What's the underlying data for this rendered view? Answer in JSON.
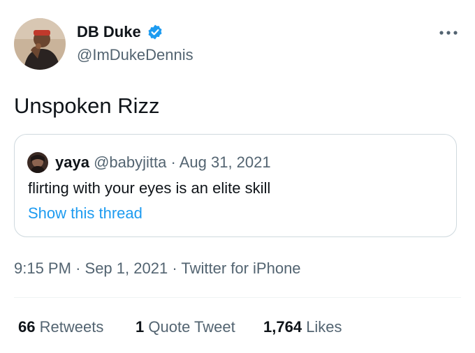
{
  "author": {
    "display_name": "DB Duke",
    "handle": "@ImDukeDennis",
    "verified_icon": "verified-badge-icon",
    "avatar": "profile-photo"
  },
  "more_icon": "more-horizontal-icon",
  "tweet": {
    "text": "Unspoken Rizz"
  },
  "quote": {
    "name": "yaya",
    "handle": "@babyjitta",
    "separator": "·",
    "date": "Aug 31, 2021",
    "text": "flirting with your eyes is an elite skill",
    "link": "Show this thread"
  },
  "meta": {
    "time": "9:15 PM",
    "sep1": "·",
    "date": "Sep 1, 2021",
    "sep2": "·",
    "source": "Twitter for iPhone"
  },
  "stats": {
    "retweets_count": "66",
    "retweets_label": "Retweets",
    "quotes_count": "1",
    "quotes_label": "Quote Tweet",
    "likes_count": "1,764",
    "likes_label": "Likes"
  },
  "colors": {
    "text": "#0f1419",
    "secondary": "#536471",
    "link": "#1d9bf0",
    "border": "#cfd9de"
  }
}
